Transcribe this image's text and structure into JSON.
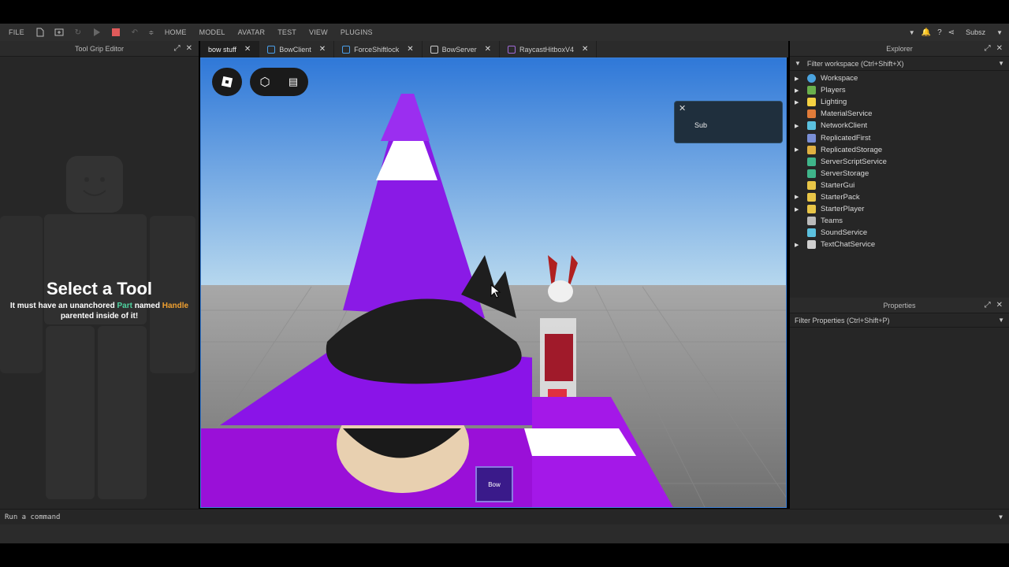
{
  "menubar": {
    "file": "FILE",
    "tabs": [
      "HOME",
      "MODEL",
      "AVATAR",
      "TEST",
      "VIEW",
      "PLUGINS"
    ],
    "user": "Subsz"
  },
  "left_panel": {
    "title": "Tool Grip Editor",
    "heading": "Select a Tool",
    "line1_a": "It must have an unanchored ",
    "line1_part": "Part",
    "line1_b": " named ",
    "line1_handle": "Handle",
    "line2": "parented inside of it!"
  },
  "editor_tabs": [
    {
      "label": "bow stuff",
      "icon_color": ""
    },
    {
      "label": "BowClient",
      "icon_color": "#4a9ee8"
    },
    {
      "label": "ForceShiftlock",
      "icon_color": "#4a9ee8"
    },
    {
      "label": "BowServer",
      "icon_color": "#cccccc"
    },
    {
      "label": "RaycastHitboxV4",
      "icon_color": "#a06ad8"
    }
  ],
  "viewport": {
    "sub_label": "Sub",
    "hotbar_label": "Bow"
  },
  "explorer": {
    "title": "Explorer",
    "filter": "Filter workspace (Ctrl+Shift+X)",
    "items": [
      {
        "label": "Workspace",
        "expandable": true,
        "icon": "globe-icon",
        "color": "#4aa3df"
      },
      {
        "label": "Players",
        "expandable": true,
        "icon": "players-icon",
        "color": "#6ab04c"
      },
      {
        "label": "Lighting",
        "expandable": true,
        "icon": "bulb-icon",
        "color": "#f5d142"
      },
      {
        "label": "MaterialService",
        "expandable": false,
        "icon": "material-icon",
        "color": "#e07b39"
      },
      {
        "label": "NetworkClient",
        "expandable": true,
        "icon": "network-icon",
        "color": "#5bc0de"
      },
      {
        "label": "ReplicatedFirst",
        "expandable": false,
        "icon": "replicated-first-icon",
        "color": "#7a8fd6"
      },
      {
        "label": "ReplicatedStorage",
        "expandable": true,
        "icon": "replicated-storage-icon",
        "color": "#e0b040"
      },
      {
        "label": "ServerScriptService",
        "expandable": false,
        "icon": "server-script-icon",
        "color": "#3fb58a"
      },
      {
        "label": "ServerStorage",
        "expandable": false,
        "icon": "server-storage-icon",
        "color": "#3fb58a"
      },
      {
        "label": "StarterGui",
        "expandable": false,
        "icon": "folder-icon",
        "color": "#e8c547"
      },
      {
        "label": "StarterPack",
        "expandable": true,
        "icon": "folder-icon",
        "color": "#e8c547"
      },
      {
        "label": "StarterPlayer",
        "expandable": true,
        "icon": "folder-icon",
        "color": "#e8c547"
      },
      {
        "label": "Teams",
        "expandable": false,
        "icon": "teams-icon",
        "color": "#bbbbbb"
      },
      {
        "label": "SoundService",
        "expandable": false,
        "icon": "sound-icon",
        "color": "#5bc0de"
      },
      {
        "label": "TextChatService",
        "expandable": true,
        "icon": "chat-icon",
        "color": "#d0d0d0"
      }
    ]
  },
  "properties": {
    "title": "Properties",
    "filter": "Filter Properties (Ctrl+Shift+P)"
  },
  "command_bar": {
    "placeholder": "Run a command"
  }
}
